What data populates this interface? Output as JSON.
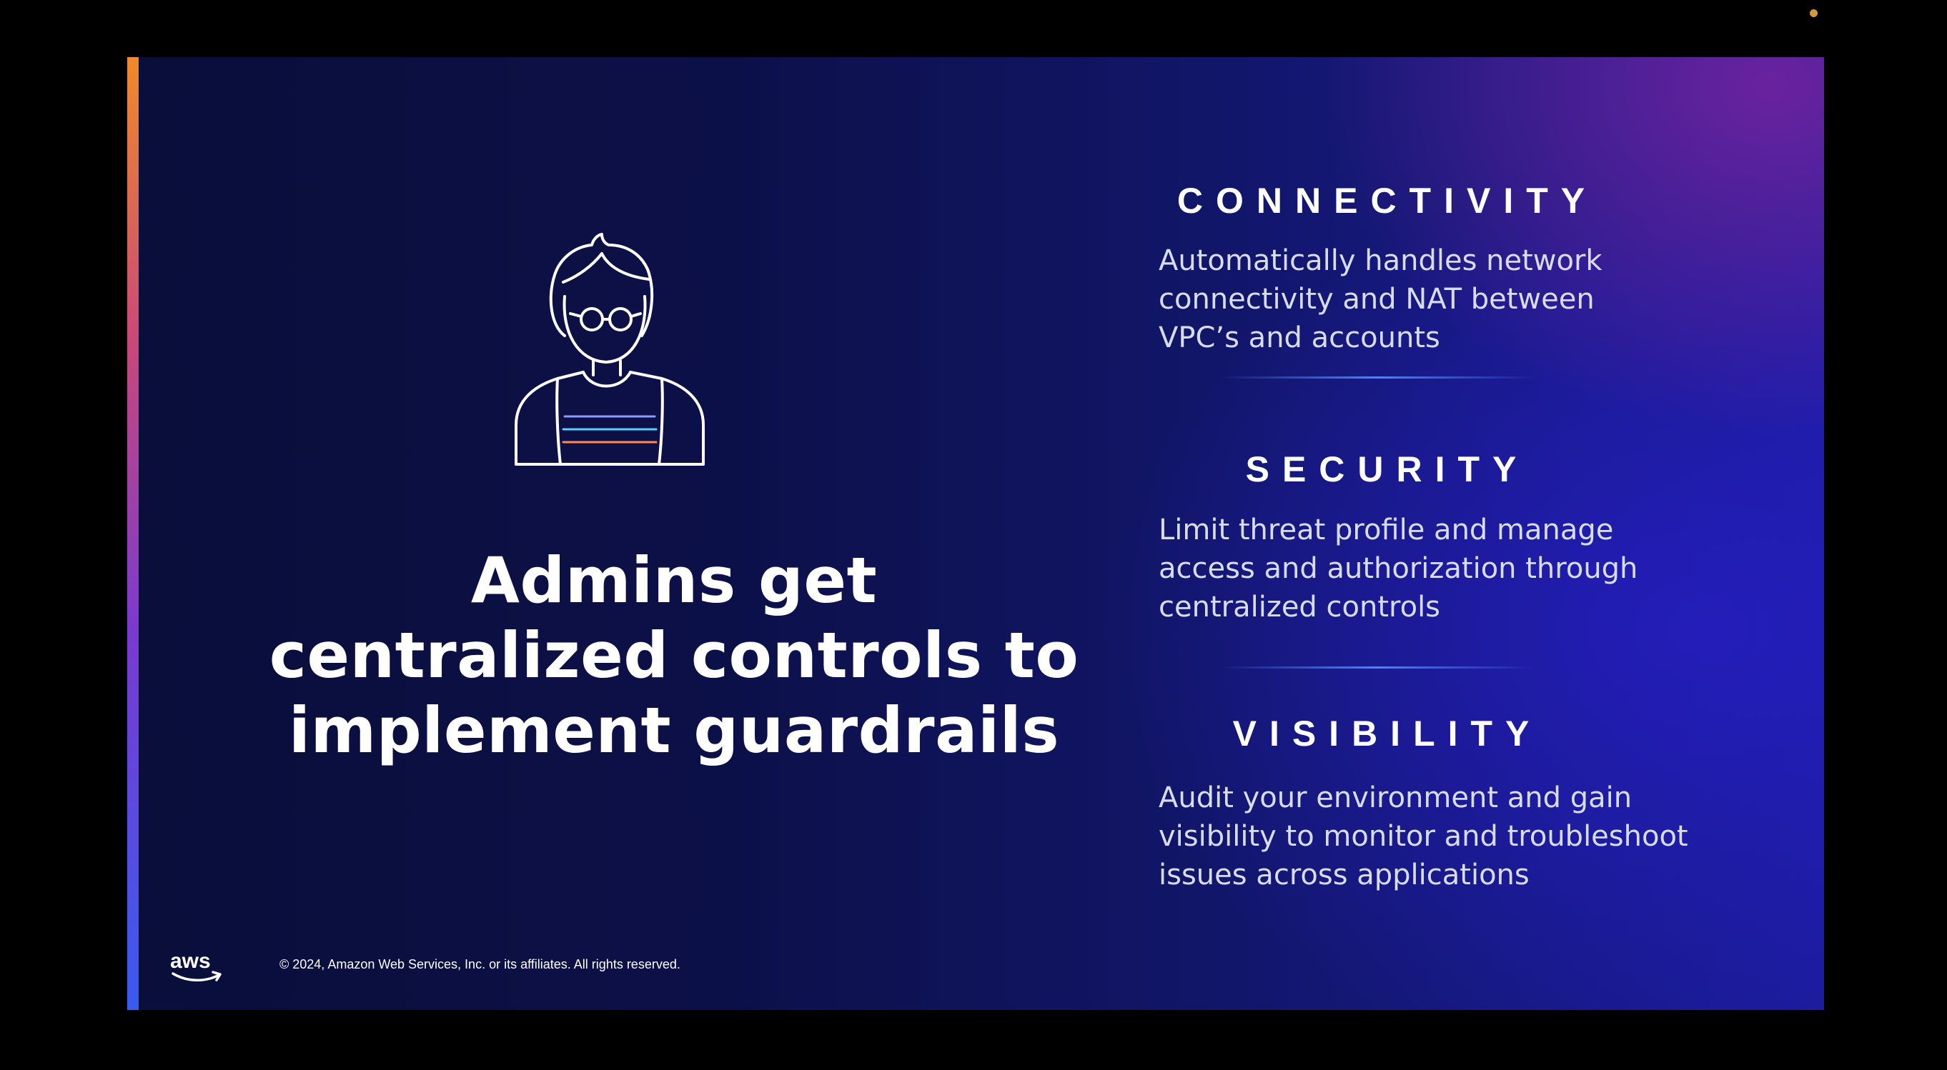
{
  "slide": {
    "headline": [
      "Admins get",
      "centralized controls to",
      "implement guardrails"
    ],
    "features": [
      {
        "heading": "CONNECTIVITY",
        "lines": [
          "Automatically handles network",
          "connectivity and NAT between",
          "VPC’s and accounts"
        ]
      },
      {
        "heading": "SECURITY",
        "lines": [
          "Limit threat profile and manage",
          "access and authorization through",
          "centralized controls"
        ]
      },
      {
        "heading": "VISIBILITY",
        "lines": [
          "Audit your environment and gain",
          "visibility to monitor and troubleshoot",
          "issues across applications"
        ]
      }
    ],
    "footer": {
      "logo_text": "aws",
      "copyright": "© 2024, Amazon Web Services, Inc. or its affiliates. All rights reserved."
    }
  },
  "icons": {
    "avatar": "person-with-glasses-icon",
    "logo": "aws-logo-icon"
  },
  "colors": {
    "background": "#000000",
    "slide_dark": "#0a0e3a",
    "slide_purple": "#7824a0",
    "divider_blue": "#3c8cff",
    "accent_orange": "#f08a2a",
    "accent_blue": "#3a5af0",
    "text": "#ffffff"
  }
}
